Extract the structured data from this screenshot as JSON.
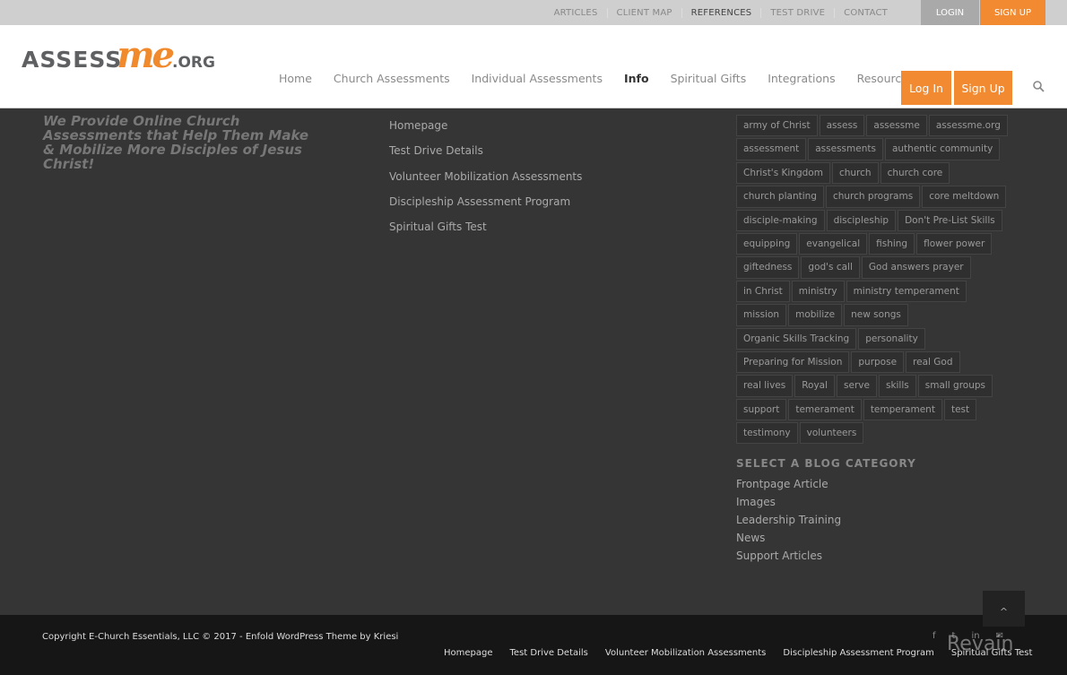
{
  "topbar": {
    "links": [
      "ARTICLES",
      "CLIENT MAP",
      "REFERENCES",
      "TEST DRIVE",
      "CONTACT"
    ],
    "login": "LOGIN",
    "signup": "SIGN UP"
  },
  "logo": {
    "assess": "ASSESS",
    "me": "me",
    "org": ".ORG"
  },
  "nav": {
    "items": [
      "Home",
      "Church Assessments",
      "Individual Assessments",
      "Info",
      "Spiritual Gifts",
      "Integrations",
      "Resources"
    ],
    "login": "Log In",
    "signup": "Sign Up",
    "search_icon": "search-icon"
  },
  "colors": {
    "accent": "#f28a32",
    "footer_bg": "#353535",
    "bottom_bg": "#161616"
  },
  "footer": {
    "tagline": "We Provide Online Church Assessments that Help Them Make & Mobilize More Disciples of Jesus Christ!",
    "links": [
      "Homepage",
      "Test Drive Details",
      "Volunteer Mobilization Assessments",
      "Discipleship Assessment Program",
      "Spiritual Gifts Test"
    ],
    "tags": [
      "army of Christ",
      "assess",
      "assessme",
      "assessme.org",
      "assessment",
      "assessments",
      "authentic community",
      "Christ's Kingdom",
      "church",
      "church core",
      "church planting",
      "church programs",
      "core meltdown",
      "disciple-making",
      "discipleship",
      "Don't Pre-List Skills",
      "equipping",
      "evangelical",
      "fishing",
      "flower power",
      "giftedness",
      "god's call",
      "God answers prayer",
      "in Christ",
      "ministry",
      "ministry temperament",
      "mission",
      "mobilize",
      "new songs",
      "Organic Skills Tracking",
      "personality",
      "Preparing for Mission",
      "purpose",
      "real God",
      "real lives",
      "Royal",
      "serve",
      "skills",
      "small groups",
      "support",
      "temerament",
      "temperament",
      "test",
      "testimony",
      "volunteers"
    ],
    "category_heading": "SELECT A BLOG CATEGORY",
    "categories": [
      "Frontpage Article",
      "Images",
      "Leadership Training",
      "News",
      "Support Articles"
    ]
  },
  "bottom": {
    "copyright": "Copyright E-Church Essentials, LLC © 2017 - Enfold WordPress Theme by Kriesi",
    "social": [
      "f",
      "t",
      "in",
      "✉"
    ],
    "links": [
      "Homepage",
      "Test Drive Details",
      "Volunteer Mobilization Assessments",
      "Discipleship Assessment Program",
      "Spiritual Gifts Test"
    ],
    "watermark": "Revain"
  }
}
